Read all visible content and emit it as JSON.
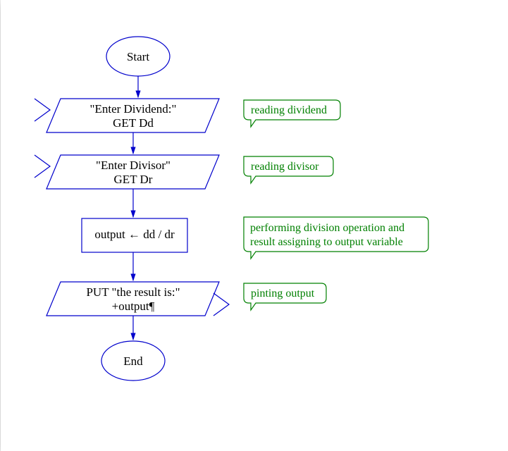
{
  "flowchart": {
    "start": "Start",
    "end": "End",
    "step1": {
      "line1": "\"Enter Dividend:\"",
      "line2": "GET Dd"
    },
    "step2": {
      "line1": "\"Enter Divisor\"",
      "line2": "GET Dr"
    },
    "step3": "output ← dd / dr",
    "step4": {
      "line1": "PUT \"the result is:\"",
      "line2": "+output¶"
    }
  },
  "annot": {
    "a1": "reading dividend",
    "a2": "reading divisor",
    "a3_l1": "performing division operation and",
    "a3_l2": "result assigning to output variable",
    "a4": "pinting output"
  }
}
